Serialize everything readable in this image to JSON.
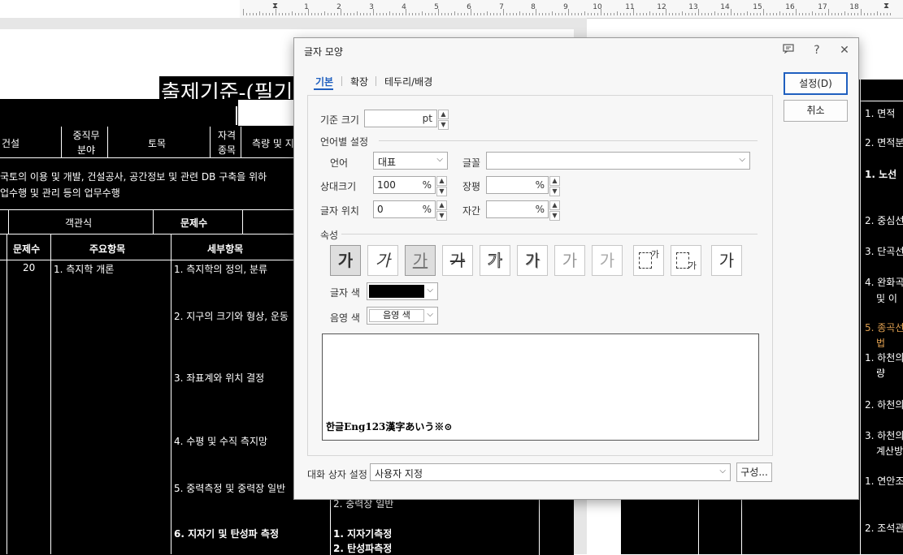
{
  "ruler": {
    "numbers": [
      "1",
      "2",
      "3",
      "4",
      "5",
      "6",
      "7",
      "8",
      "9",
      "10",
      "11",
      "12",
      "13",
      "14",
      "15",
      "16",
      "17",
      "18"
    ]
  },
  "document": {
    "heading": "출제기준-(필기",
    "header_row": [
      "건설",
      "중직무 분야",
      "토목",
      "자격 종목",
      "측량 및 지"
    ],
    "desc_line1": "국토의 이용 및 개발, 건설공사, 공간정보 및 관련 DB 구축을 위하",
    "desc_line2": "업수행 및 관리 등의 업무수행",
    "row_method": [
      "객관식",
      "문제수"
    ],
    "columns": [
      "문제수",
      "주요항목",
      "세부항목"
    ],
    "count": "20",
    "main_item": "1. 측지학 개론",
    "sub_items": [
      "1. 측지학의 정의, 분류",
      "2. 지구의 크기와 형상, 운동",
      "3. 좌표계와 위치 결정",
      "4. 수평 및 수직 측지망",
      "5. 중력측정 및 중력장 일반",
      "6. 지자기 및 탄성파 측정"
    ],
    "detail_items": [
      "2. 중력장 일반",
      "1. 지자기측정",
      "2. 탄성파측정"
    ],
    "right_items": [
      "1. 면적",
      "2. 면적분",
      "1. 노선",
      "2. 중심선",
      "3. 단곡선",
      "4. 완화곡",
      "및 이",
      "5. 종곡선",
      "법",
      "1. 하천의",
      "량",
      "2. 하천의",
      "3. 하천의",
      "계산방",
      "1. 연안조",
      "2. 조석관"
    ]
  },
  "dialog": {
    "title": "글자 모양",
    "tabs": [
      "기본",
      "확장",
      "테두리/배경"
    ],
    "base_size_label": "기준 크기",
    "base_size_unit": "pt",
    "lang_group": "언어별 설정",
    "language_label": "언어",
    "language_value": "대표",
    "font_label": "글꼴",
    "font_value": "",
    "rel_size_label": "상대크기",
    "rel_size_value": "100",
    "width_label": "장평",
    "position_label": "글자 위치",
    "position_value": "0",
    "spacing_label": "자간",
    "percent": "%",
    "attr_group": "속성",
    "attr_buttons": [
      "가",
      "가",
      "가",
      "가",
      "가",
      "가",
      "가",
      "가",
      "가",
      "가",
      "가"
    ],
    "text_color_label": "글자 색",
    "text_color": "#000000",
    "shade_color_label": "음영 색",
    "shade_color_value": "음영 색",
    "preview_sample": "한글Eng123漢字あいう※⊙",
    "preset_label": "대화 상자 설정",
    "preset_value": "사용자 지정",
    "configure_button": "구성...",
    "ok_button": "설정(D)",
    "cancel_button": "취소"
  }
}
